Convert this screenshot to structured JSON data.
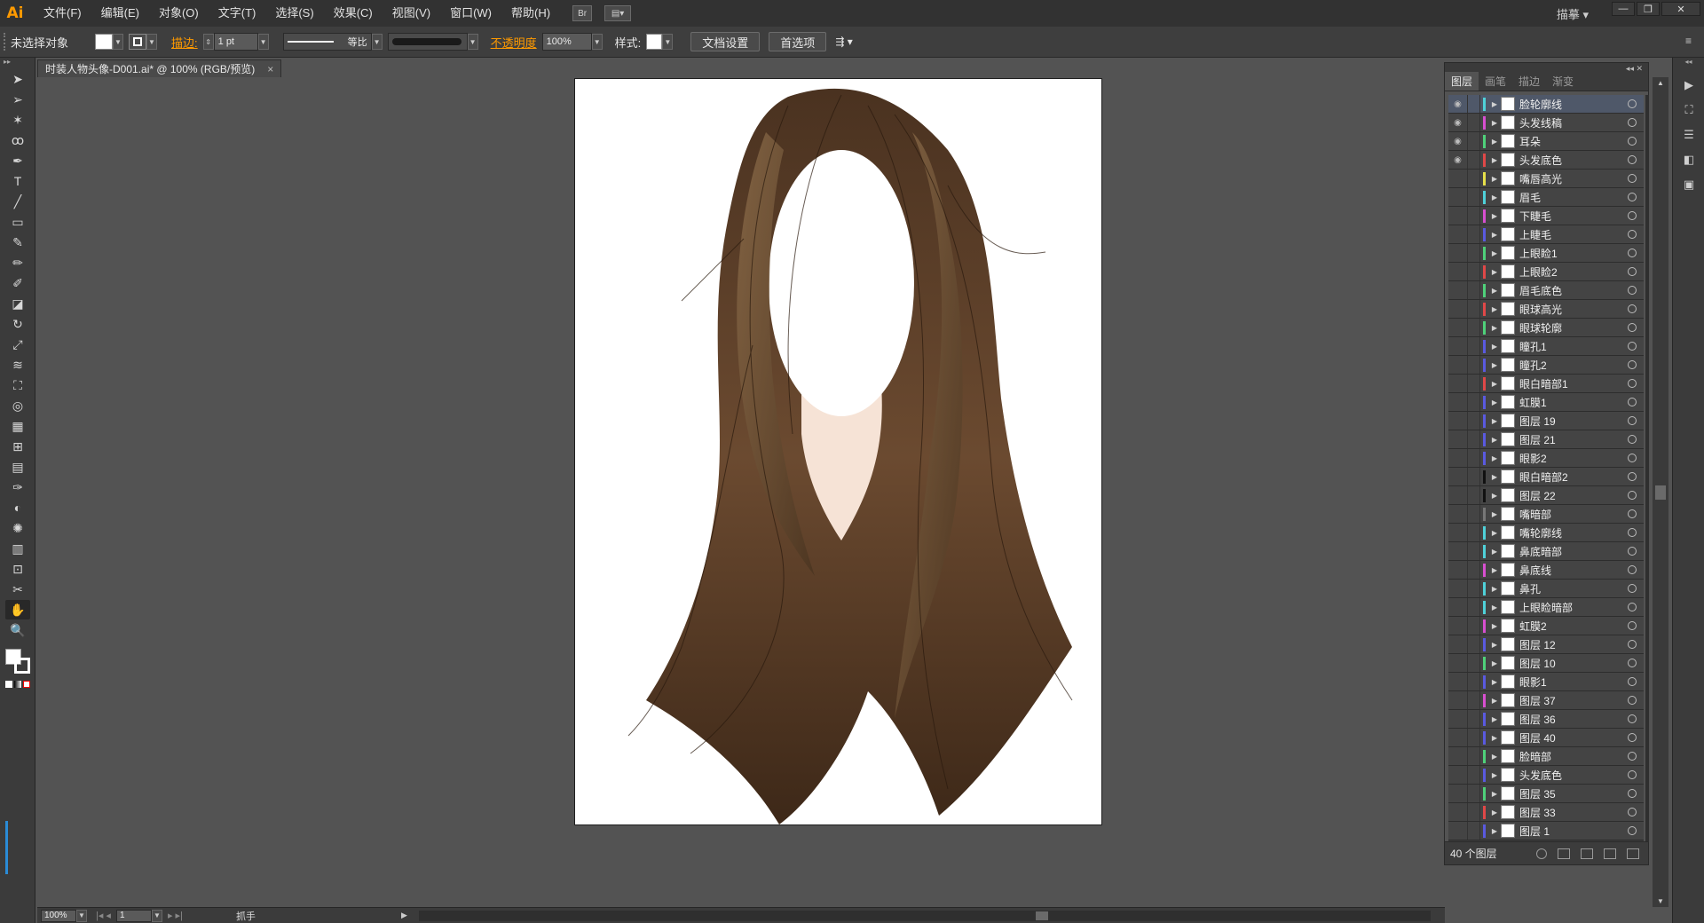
{
  "app": {
    "logo": "Ai",
    "workspace": "描摹 ▾"
  },
  "menu": [
    "文件(F)",
    "编辑(E)",
    "对象(O)",
    "文字(T)",
    "选择(S)",
    "效果(C)",
    "视图(V)",
    "窗口(W)",
    "帮助(H)"
  ],
  "menu_icons": {
    "bridge": "Br",
    "arrange": "▤▾"
  },
  "window_buttons": {
    "minimize": "—",
    "restore": "❐",
    "close": "✕"
  },
  "control": {
    "selection": "未选择对象",
    "stroke_label": "描边:",
    "stroke_value": "1 pt",
    "brush_profile": "等比",
    "opacity_label": "不透明度",
    "opacity_value": "100%",
    "style_label": "样式:",
    "doc_setup": "文档设置",
    "preferences": "首选项"
  },
  "document": {
    "tab_title": "时装人物头像-D001.ai* @ 100% (RGB/预览)",
    "close": "×"
  },
  "status": {
    "zoom": "100%",
    "page": "1",
    "tool": "抓手"
  },
  "layers_panel": {
    "tabs": [
      "图层",
      "画笔",
      "描边",
      "渐变"
    ],
    "footer": "40 个图层",
    "layers": [
      {
        "name": "脸轮廓线",
        "color": "#4fd1d9",
        "visible": true,
        "selected": true
      },
      {
        "name": "头发线稿",
        "color": "#d84fd0",
        "visible": true
      },
      {
        "name": "耳朵",
        "color": "#4fd17a",
        "visible": true
      },
      {
        "name": "头发底色",
        "color": "#e04848",
        "visible": true
      },
      {
        "name": "嘴唇高光",
        "color": "#e6e04a",
        "visible": false
      },
      {
        "name": "眉毛",
        "color": "#4fd1d9",
        "visible": false
      },
      {
        "name": "下睫毛",
        "color": "#d84fd0",
        "visible": false
      },
      {
        "name": "上睫毛",
        "color": "#5a5ae0",
        "visible": false
      },
      {
        "name": "上眼睑1",
        "color": "#4fd17a",
        "visible": false
      },
      {
        "name": "上眼睑2",
        "color": "#e04848",
        "visible": false
      },
      {
        "name": "眉毛底色",
        "color": "#4fd17a",
        "visible": false
      },
      {
        "name": "眼球高光",
        "color": "#e04848",
        "visible": false
      },
      {
        "name": "眼球轮廓",
        "color": "#4fd17a",
        "visible": false
      },
      {
        "name": "瞳孔1",
        "color": "#5a5ae0",
        "visible": false
      },
      {
        "name": "瞳孔2",
        "color": "#5a5ae0",
        "visible": false
      },
      {
        "name": "眼白暗部1",
        "color": "#e04848",
        "visible": false
      },
      {
        "name": "虹膜1",
        "color": "#5a5ae0",
        "visible": false
      },
      {
        "name": "图层 19",
        "color": "#5a5ae0",
        "visible": false
      },
      {
        "name": "图层 21",
        "color": "#5a5ae0",
        "visible": false
      },
      {
        "name": "眼影2",
        "color": "#5a5ae0",
        "visible": false
      },
      {
        "name": "眼白暗部2",
        "color": "#111111",
        "visible": false
      },
      {
        "name": "图层 22",
        "color": "#111111",
        "visible": false
      },
      {
        "name": "嘴暗部",
        "color": "#777777",
        "visible": false
      },
      {
        "name": "嘴轮廓线",
        "color": "#4fd1d9",
        "visible": false
      },
      {
        "name": "鼻底暗部",
        "color": "#4fd1d9",
        "visible": false
      },
      {
        "name": "鼻底线",
        "color": "#d84fd0",
        "visible": false
      },
      {
        "name": "鼻孔",
        "color": "#4fd1d9",
        "visible": false
      },
      {
        "name": "上眼睑暗部",
        "color": "#4fd1d9",
        "visible": false
      },
      {
        "name": "虹膜2",
        "color": "#d84fd0",
        "visible": false
      },
      {
        "name": "图层 12",
        "color": "#5a5ae0",
        "visible": false
      },
      {
        "name": "图层 10",
        "color": "#4fd17a",
        "visible": false
      },
      {
        "name": "眼影1",
        "color": "#5a5ae0",
        "visible": false
      },
      {
        "name": "图层 37",
        "color": "#d84fd0",
        "visible": false
      },
      {
        "name": "图层 36",
        "color": "#5a5ae0",
        "visible": false
      },
      {
        "name": "图层 40",
        "color": "#5a5ae0",
        "visible": false
      },
      {
        "name": "脸暗部",
        "color": "#4fd17a",
        "visible": false
      },
      {
        "name": "头发底色",
        "color": "#5a5ae0",
        "visible": false
      },
      {
        "name": "图层 35",
        "color": "#4fd17a",
        "visible": false
      },
      {
        "name": "图层 33",
        "color": "#e04848",
        "visible": false
      },
      {
        "name": "图层 1",
        "color": "#5a5ae0",
        "visible": false
      }
    ]
  },
  "tools": [
    "selection-tool",
    "direct-selection-tool",
    "magic-wand-tool",
    "lasso-tool",
    "pen-tool",
    "type-tool",
    "line-tool",
    "rectangle-tool",
    "paintbrush-tool",
    "pencil-tool",
    "blob-brush-tool",
    "eraser-tool",
    "rotate-tool",
    "scale-tool",
    "warp-tool",
    "free-transform-tool",
    "shape-builder-tool",
    "perspective-grid-tool",
    "mesh-tool",
    "gradient-tool",
    "eyedropper-tool",
    "blend-tool",
    "symbol-sprayer-tool",
    "column-graph-tool",
    "artboard-tool",
    "slice-tool",
    "hand-tool",
    "zoom-tool"
  ],
  "colors": {
    "accent": "#ff9a00",
    "hair_dark": "#3a2616",
    "hair_mid": "#6a4a30",
    "hair_light": "#9c7a55",
    "skin": "#f6e3d6"
  }
}
